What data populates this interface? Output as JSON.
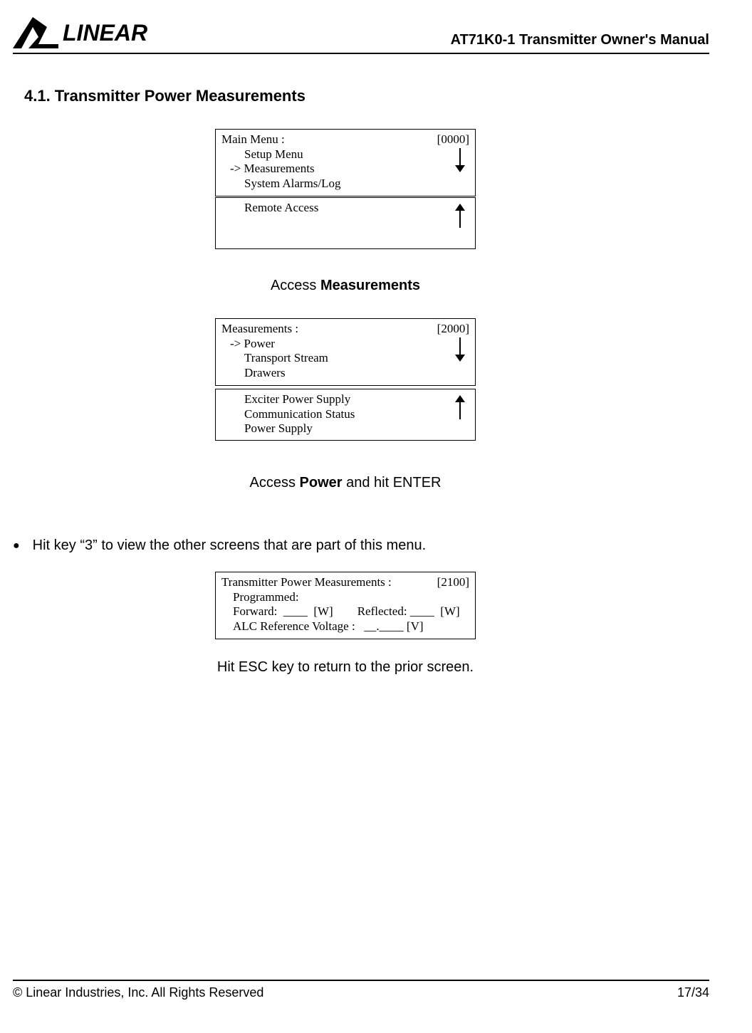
{
  "brand": "LINEAR",
  "doc_title": "AT71K0-1 Transmitter Owner's Manual",
  "section_heading": "4.1. Transmitter Power Measurements",
  "lcd1": {
    "title": "Main Menu :",
    "code": "[0000]",
    "lines": [
      "Setup Menu",
      "-> Measurements",
      "System Alarms/Log"
    ]
  },
  "lcd2": {
    "lines": [
      "Remote Access"
    ]
  },
  "caption1_pre": "Access ",
  "caption1_bold": "Measurements",
  "lcd3": {
    "title": "Measurements :",
    "code": "[2000]",
    "lines": [
      "-> Power",
      "Transport Stream",
      "Drawers"
    ]
  },
  "lcd4": {
    "lines": [
      "Exciter Power Supply",
      "Communication Status",
      "Power Supply"
    ]
  },
  "caption2_pre": "Access ",
  "caption2_bold": "Power",
  "caption2_post": " and hit ENTER",
  "bullet_text": "Hit key “3” to view the other screens that are part of this menu.",
  "lcd5": {
    "title": "Transmitter Power Measurements :",
    "code": "[2100]",
    "lines": [
      "Programmed:",
      "Forward:  ____  [W]        Reflected: ____  [W]",
      "ALC Reference Voltage :   __.____ [V]"
    ]
  },
  "caption3": "Hit ESC key to return to the prior screen.",
  "footer_left": "© Linear Industries, Inc. All Rights Reserved",
  "footer_right": "17/34"
}
